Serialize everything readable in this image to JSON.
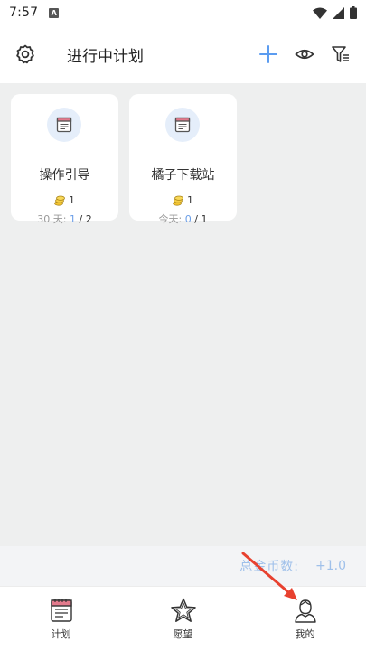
{
  "status_bar": {
    "time": "7:57",
    "notification_letter": "A"
  },
  "header": {
    "title": "进行中计划"
  },
  "plans": [
    {
      "name": "操作引导",
      "coins": "1",
      "period_label": "30 天: ",
      "done": "1",
      "separator": " / ",
      "total": "2"
    },
    {
      "name": "橘子下载站",
      "coins": "1",
      "period_label": "今天: ",
      "done": "0",
      "separator": " / ",
      "total": "1"
    }
  ],
  "coins_summary": {
    "label": "总金币数:",
    "value": "+1.0"
  },
  "bottom_nav": [
    {
      "label": "计划"
    },
    {
      "label": "愿望"
    },
    {
      "label": "我的"
    }
  ],
  "colors": {
    "accent": "#5b9cf0",
    "background": "#eeefef",
    "annotation_arrow": "#e8412f"
  }
}
